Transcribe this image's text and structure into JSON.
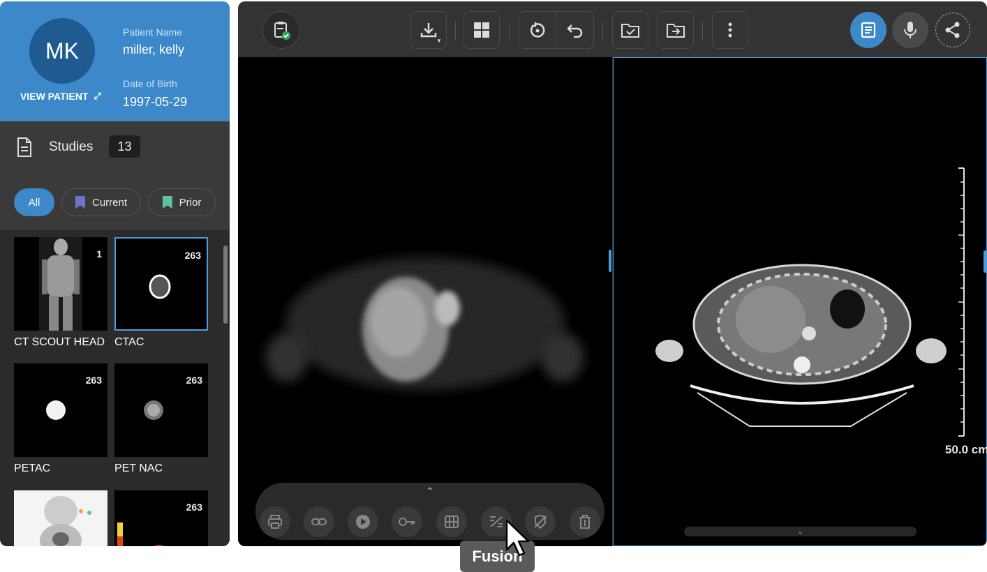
{
  "patient": {
    "initials": "MK",
    "view_patient_label": "VIEW PATIENT",
    "name_label": "Patient Name",
    "name": "miller, kelly",
    "dob_label": "Date of Birth",
    "dob": "1997-05-29"
  },
  "studies": {
    "title": "Studies",
    "count": "13",
    "filters": [
      {
        "label": "All",
        "active": true
      },
      {
        "label": "Current",
        "color": "#6a74c9"
      },
      {
        "label": "Prior",
        "color": "#5fc29a"
      }
    ],
    "thumbnails": [
      {
        "label": "CT SCOUT HEAD",
        "count": "1"
      },
      {
        "label": "CTAC",
        "count": "263",
        "selected": true
      },
      {
        "label": "PETAC",
        "count": "263"
      },
      {
        "label": "PET NAC",
        "count": "263"
      },
      {
        "label": "",
        "count": ""
      },
      {
        "label": "",
        "count": "263"
      }
    ]
  },
  "toolbar": {
    "icons": [
      "clipboard-check-icon",
      "download-icon",
      "layout-grid-icon",
      "reset-icon",
      "undo-icon",
      "folder-check-icon",
      "folder-export-icon",
      "more-vertical-icon",
      "report-icon",
      "microphone-icon",
      "share-icon"
    ]
  },
  "viewer": {
    "scale_label": "50.0 cm"
  },
  "bottom_tools": {
    "icons": [
      "print-icon",
      "link-icon",
      "play-icon",
      "key-icon",
      "grid-icon",
      "fusion-icon",
      "invert-icon",
      "trash-icon"
    ]
  },
  "tooltip": {
    "text": "Fusion"
  },
  "colors": {
    "accent": "#3d88c9",
    "selection": "#4a9be0"
  }
}
